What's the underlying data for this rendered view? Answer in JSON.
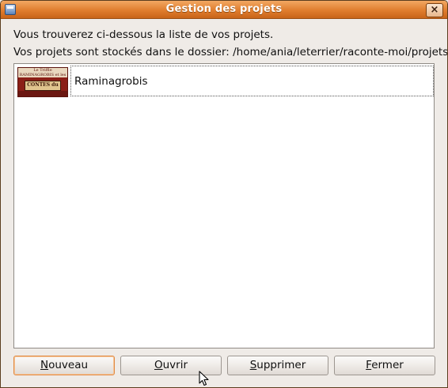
{
  "window": {
    "title": "Gestion des projets",
    "close_label": "×"
  },
  "intro": {
    "line1": "Vous trouverez ci-dessous la liste de vos projets.",
    "line2": "Vos projets sont stockés dans le dossier: /home/ania/leterrier/raconte-moi/projets/"
  },
  "projects": [
    {
      "name": "Raminagrobis",
      "thumb_top": "Le Triffle RAMINAGROBIS et les SOURIS",
      "thumb_banner": "CONTES du FOYER"
    }
  ],
  "buttons": {
    "new": {
      "mnemonic": "N",
      "rest": "ouveau"
    },
    "open": {
      "mnemonic": "O",
      "rest": "uvrir"
    },
    "delete": {
      "mnemonic": "S",
      "rest": "upprimer"
    },
    "close": {
      "mnemonic": "F",
      "rest": "ermer"
    }
  },
  "colors": {
    "titlebar": "#e07d2e",
    "default_button_border": "#e08a43"
  }
}
